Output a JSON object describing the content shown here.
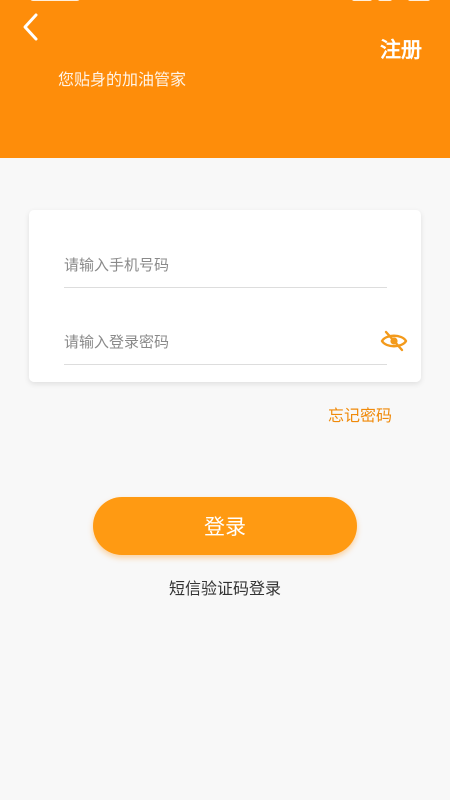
{
  "header": {
    "register_label": "注册",
    "slogan": "您贴身的加油管家",
    "background_color": "#fe8d0a"
  },
  "login_form": {
    "phone_placeholder": "请输入手机号码",
    "password_placeholder": "请输入登录密码",
    "password_visibility_icon": "eye-off-icon"
  },
  "links": {
    "forgot_password": "忘记密码",
    "sms_login": "短信验证码登录"
  },
  "actions": {
    "login_label": "登录",
    "accent_color": "#ff9a12"
  }
}
